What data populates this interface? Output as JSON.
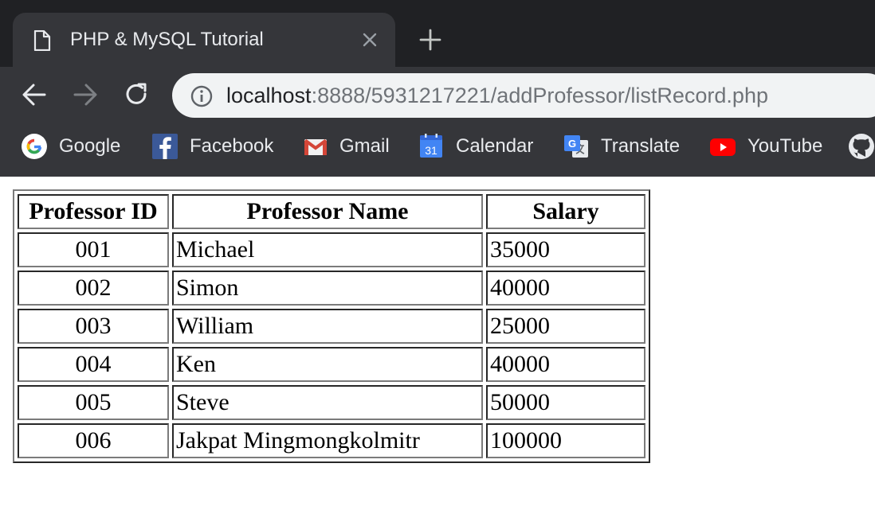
{
  "browser": {
    "tab": {
      "title": "PHP & MySQL Tutorial"
    },
    "address": {
      "host": "localhost",
      "rest": ":8888/5931217221/addProfessor/listRecord.php"
    },
    "bookmarks": [
      {
        "label": "Google",
        "icon": "google-icon"
      },
      {
        "label": "Facebook",
        "icon": "facebook-icon"
      },
      {
        "label": "Gmail",
        "icon": "gmail-icon"
      },
      {
        "label": "Calendar",
        "icon": "calendar-icon",
        "icon_text": "31"
      },
      {
        "label": "Translate",
        "icon": "translate-icon"
      },
      {
        "label": "YouTube",
        "icon": "youtube-icon"
      },
      {
        "label": "",
        "icon": "github-icon"
      }
    ],
    "colors": {
      "tabstrip": "#202124",
      "toolbar": "#35363a",
      "omnibox": "#f1f3f4"
    }
  },
  "table": {
    "headers": [
      "Professor ID",
      "Professor Name",
      "Salary"
    ],
    "rows": [
      [
        "001",
        "Michael",
        "35000"
      ],
      [
        "002",
        "Simon",
        "40000"
      ],
      [
        "003",
        "William",
        "25000"
      ],
      [
        "004",
        "Ken",
        "40000"
      ],
      [
        "005",
        "Steve",
        "50000"
      ],
      [
        "006",
        "Jakpat Mingmongkolmitr",
        "100000"
      ]
    ]
  }
}
